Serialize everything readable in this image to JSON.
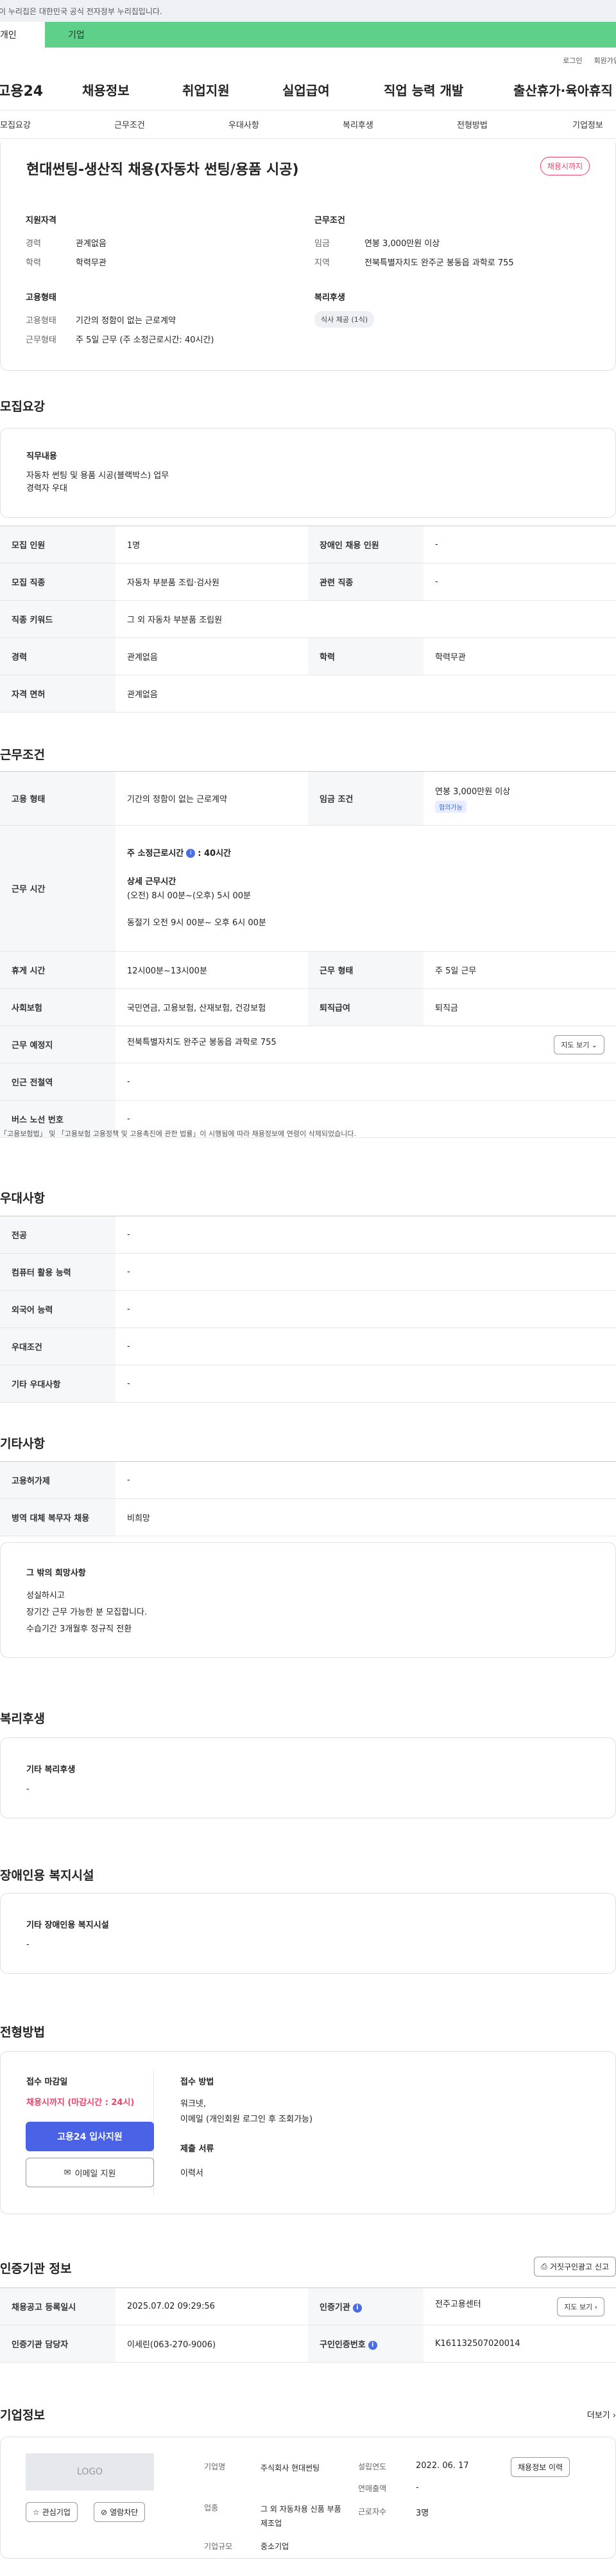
{
  "gov_banner": "이 누리집은 대한민국 공식 전자정부 누리집입니다.",
  "usertype": {
    "individual": "개인",
    "enterprise": "기업"
  },
  "util": {
    "login": "로그인",
    "join": "회원가입"
  },
  "gnb": {
    "logo": "고용24",
    "menu": [
      "채용정보",
      "취업지원",
      "실업급여",
      "직업 능력 개발",
      "출산휴가·육아휴직"
    ]
  },
  "tabs": [
    "모집요강",
    "근무조건",
    "우대사항",
    "복리후생",
    "전형방법",
    "기업정보"
  ],
  "summary": {
    "title": "현대썬팅-생산직 채용(자동차 썬팅/용품 시공)",
    "badge": "채용시까지",
    "qual_title": "지원자격",
    "career_k": "경력",
    "career_v": "관계없음",
    "edu_k": "학력",
    "edu_v": "학력무관",
    "cond_title": "근무조건",
    "wage_k": "임금",
    "wage_v": "연봉 3,000만원 이상",
    "region_k": "지역",
    "region_v": "전북특별자치도 완주군 봉동읍 과학로 755",
    "emp_title": "고용형태",
    "emptype_k": "고용형태",
    "emptype_v": "기간의 정함이 없는 근로계약",
    "worktype_k": "근무형태",
    "worktype_v": "주 5일 근무 (주 소정근로시간: 40시간)",
    "welfare_title": "복리후생",
    "welfare_chip": "식사 제공 (1식)"
  },
  "recruit": {
    "title": "모집요강",
    "duty_title": "직무내용",
    "duty_lines": [
      "자동차 썬팅 및 용품 시공(블랙박스) 업무",
      "경력자 우대"
    ],
    "rows": {
      "headcount_k": "모집 인원",
      "headcount_v": "1명",
      "disabled_k": "장애인 채용 인원",
      "disabled_v": "-",
      "job_k": "모집 직종",
      "job_v": "자동차 부분품 조립·검사원",
      "related_k": "관련 직종",
      "related_v": "-",
      "keyword_k": "직종 키워드",
      "keyword_v": "그 외 자동차 부분품 조립원",
      "career_k": "경력",
      "career_v": "관계없음",
      "edu_k": "학력",
      "edu_v": "학력무관",
      "license_k": "자격 면허",
      "license_v": "관계없음"
    }
  },
  "work": {
    "title": "근무조건",
    "emptype_k": "고용 형태",
    "emptype_v": "기간의 정함이 없는 근로계약",
    "wage_k": "임금 조건",
    "wage_v": "연봉 3,000만원 이상",
    "wage_tag": "협의가능",
    "hours_k": "근무 시간",
    "hours_weekly": "주 소정근로시간",
    "hours_weekly_v": ": 40시간",
    "hours_detail_title": "상세 근무시간",
    "hours_detail_1": "(오전) 8시 00분~(오후) 5시 00분",
    "hours_detail_2": "동절기 오전 9시 00분~ 오후 6시 00분",
    "break_k": "휴게 시간",
    "break_v": "12시00분~13시00분",
    "form_k": "근무 형태",
    "form_v": "주 5일 근무",
    "insurance_k": "사회보험",
    "insurance_v": "국민연금, 고용보험, 산재보험, 건강보험",
    "severance_k": "퇴직급여",
    "severance_v": "퇴직금",
    "place_k": "근무 예정지",
    "place_v": "전북특별자치도 완주군 봉동읍 과학로 755",
    "map_btn": "지도 보기",
    "subway_k": "인근 전철역",
    "subway_v": "-",
    "bus_k": "버스 노선 번호",
    "bus_v": "-",
    "note": "「고용보험법」 및 「고용보험 고용정책 및 고용촉진에 관한 법률」이 시행됨에 따라 채용정보에 연령이 삭제되었습니다."
  },
  "pref": {
    "title": "우대사항",
    "major_k": "전공",
    "major_v": "-",
    "pc_k": "컴퓨터 활용 능력",
    "pc_v": "-",
    "lang_k": "외국어 능력",
    "lang_v": "-",
    "cond_k": "우대조건",
    "cond_v": "-",
    "etc_k": "기타 우대사항",
    "etc_v": "-"
  },
  "other": {
    "title": "기타사항",
    "mobile_k": "고용허가제",
    "mobile_v": "-",
    "military_k": "병역 대체 복무자 채용",
    "military_v": "비희망",
    "wish_title": "그 밖의 희망사항",
    "wish_lines": [
      "성실하시고",
      "장기간 근무 가능한 분 모집합니다.",
      "수습기간 3개월후 정규직 전환"
    ]
  },
  "welfare": {
    "title": "복리후생",
    "etc_title": "기타 복리후생",
    "etc_v": "-"
  },
  "disability": {
    "title": "장애인용 복지시설",
    "etc_title": "기타 장애인용 복지시설",
    "etc_v": "-"
  },
  "process": {
    "title": "전형방법",
    "deadline_title": "접수 마감일",
    "deadline_v": "채용시까지 (마감시간 : 24시)",
    "apply_btn": "고용24 입사지원",
    "email_btn": "이메일 지원",
    "method_title": "접수 방법",
    "method_v1": "워크넷,",
    "method_v2": "이메일 (개인회원 로그인 후 조회가능)",
    "docs_title": "제출 서류",
    "docs_v": "이력서"
  },
  "cert": {
    "title": "인증기관 정보",
    "report_btn": "거짓구인광고 신고",
    "reg_k": "채용공고 등록일시",
    "reg_v": "2025.07.02 09:29:56",
    "org_k": "인증기관",
    "org_v": "전주고용센터",
    "map_btn": "지도 보기",
    "manager_k": "인증기관 담당자",
    "manager_v": "이세린(063-270-9006)",
    "id_k": "구인인증번호",
    "id_v": "K161132507020014"
  },
  "company": {
    "title": "기업정보",
    "more": "더보기",
    "logo": "LOGO",
    "fav_btn": "관심기업",
    "block_btn": "열람차단",
    "name_k": "기업명",
    "name_v": "주식회사 현대썬팅",
    "founded_k": "설립연도",
    "founded_v": "2022. 06. 17",
    "sales_k": "연매출액",
    "sales_v": "-",
    "ind_k": "업종",
    "ind_v": "그 외 자동차용 신품 부품 제조업",
    "emp_k": "근로자수",
    "emp_v": "3명",
    "scale_k": "기업규모",
    "scale_v": "중소기업",
    "jobs_btn": "채용정보 이력"
  }
}
